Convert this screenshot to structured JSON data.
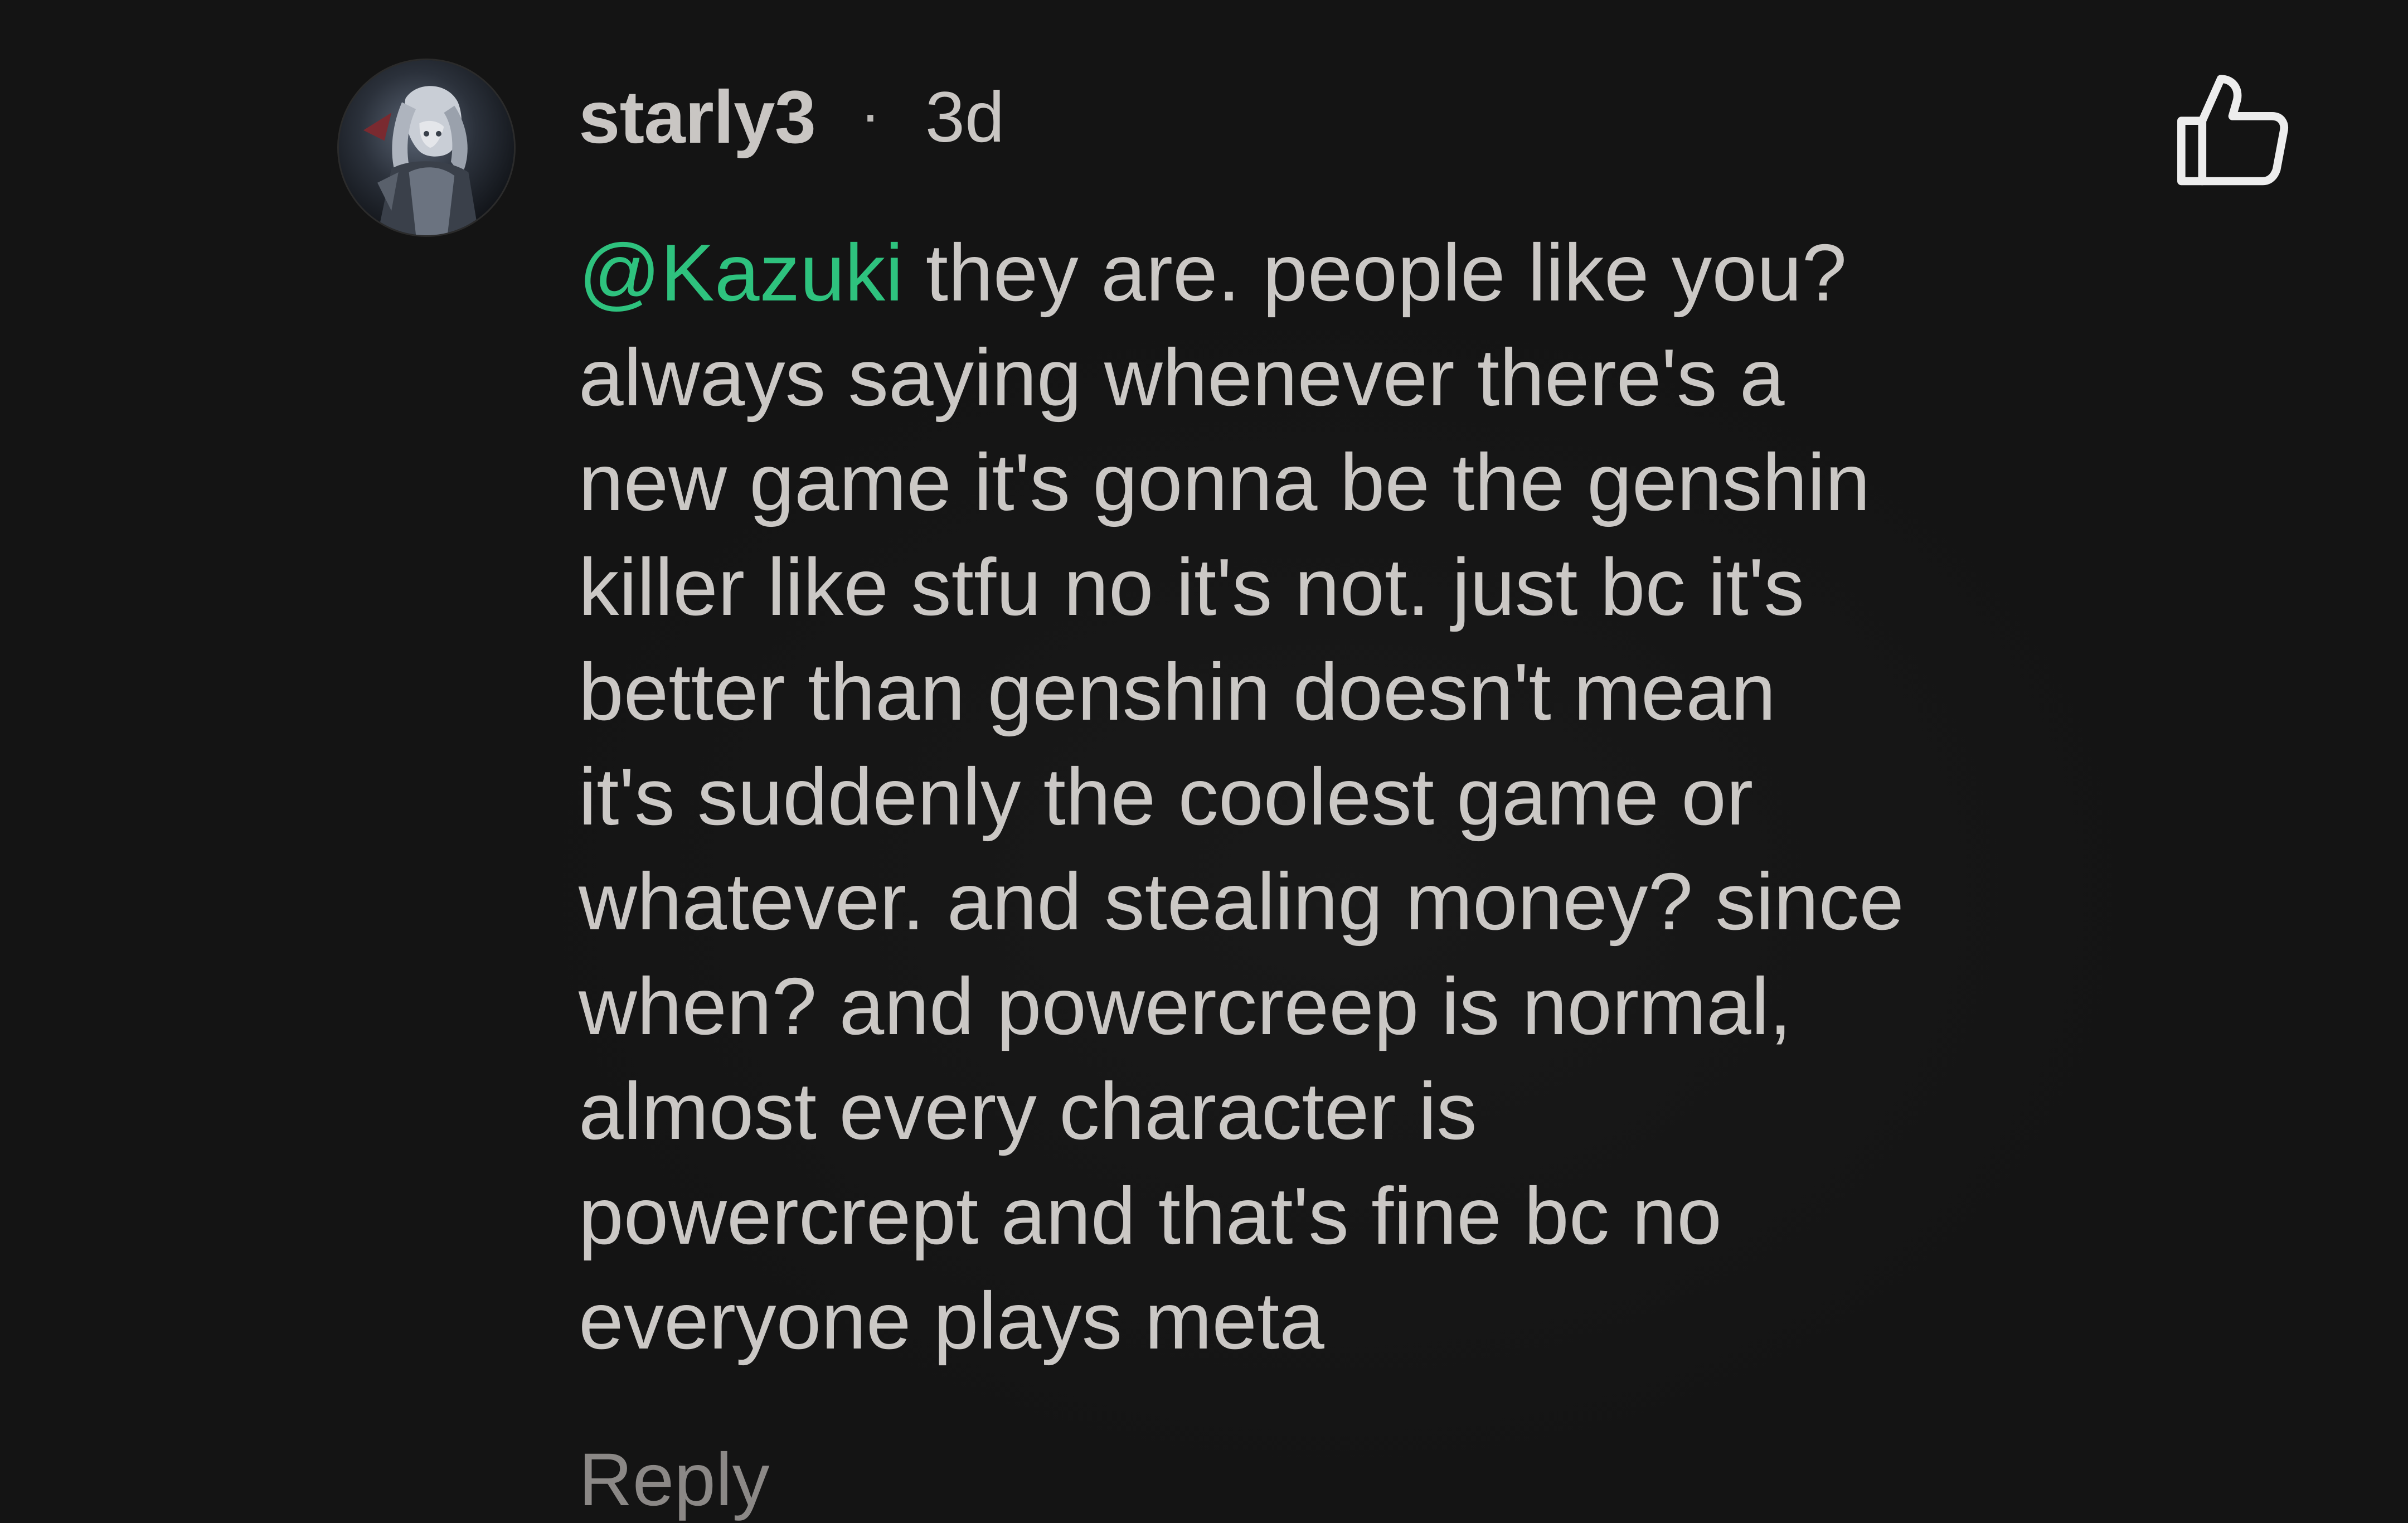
{
  "comment": {
    "username": "starly3",
    "separator": "·",
    "time_ago": "3d",
    "avatar_icon": "anime-character-avatar",
    "like_icon": "thumbs-up-icon",
    "mention": "@Kazuki",
    "body_lines": [
      " they are. people like you?",
      "always saying whenever there's a",
      "new game it's gonna be the genshin",
      "killer like stfu no it's not. just bc it's",
      "better than genshin doesn't mean",
      "it's suddenly the coolest game or",
      "whatever. and stealing money? since",
      "when? and powercreep is normal,",
      "almost every character is",
      "powercrept and that's fine bc no",
      "everyone plays meta"
    ],
    "reply_label": "Reply",
    "colors": {
      "background": "#141414",
      "text": "#cbc8c5",
      "mention": "#2ec27e",
      "muted": "#8b8886"
    }
  }
}
